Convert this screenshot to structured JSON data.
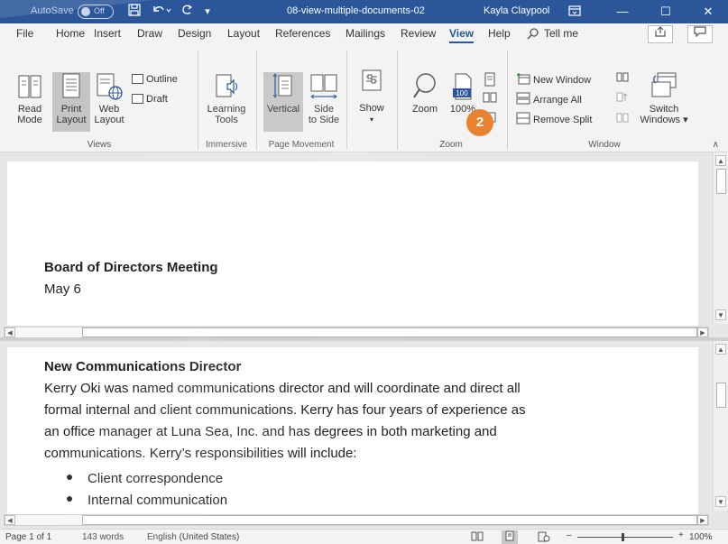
{
  "titlebar": {
    "autosave_label": "AutoSave",
    "autosave_state": "Off",
    "doc_title": "08-view-multiple-documents-02",
    "user": "Kayla Claypool",
    "minimize": "—",
    "maximize": "☐",
    "close": "✕"
  },
  "tabs": [
    "File",
    "Home",
    "Insert",
    "Draw",
    "Design",
    "Layout",
    "References",
    "Mailings",
    "Review",
    "View",
    "Help",
    "Tell me"
  ],
  "ribbon": {
    "views": {
      "read_mode": [
        "Read",
        "Mode"
      ],
      "print_layout": [
        "Print",
        "Layout"
      ],
      "web_layout": [
        "Web",
        "Layout"
      ],
      "outline": "Outline",
      "draft": "Draft",
      "group_label": "Views"
    },
    "immersive": {
      "learning_tools": [
        "Learning",
        "Tools"
      ],
      "group_label": "Immersive"
    },
    "page_movement": {
      "vertical": "Vertical",
      "side_to_side": [
        "Side",
        "to Side"
      ],
      "group_label": "Page Movement"
    },
    "show": {
      "label": "Show"
    },
    "zoom": {
      "zoom": "Zoom",
      "hundred": "100%",
      "hundred_icon": "100",
      "group_label": "Zoom"
    },
    "window": {
      "new_window": "New Window",
      "arrange_all": "Arrange All",
      "remove_split": "Remove Split",
      "switch_windows": [
        "Switch",
        "Windows ▾"
      ],
      "group_label": "Window"
    },
    "step_badge": "2"
  },
  "document": {
    "pane1": {
      "heading": "Board of Directors Meeting",
      "date": "May 6"
    },
    "pane2": {
      "heading": "New Communications Director",
      "lines": [
        "Kerry Oki was named communications director and will coordinate and direct all",
        "formal internal and client communications. Kerry has four years of experience as",
        "an office manager at Luna Sea, Inc. and has degrees in both marketing and",
        "communications. Kerry’s responsibilities will include:"
      ],
      "bullets": [
        "Client correspondence",
        "Internal communication"
      ]
    }
  },
  "status": {
    "page": "Page 1 of 1",
    "words": "143 words",
    "language": "English (United States)",
    "zoom_pct": "100%",
    "zoom_minus": "–",
    "zoom_plus": "+"
  },
  "colors": {
    "title_bar": "#2b579a",
    "accent": "#2b579a",
    "badge": "#e8822f"
  }
}
